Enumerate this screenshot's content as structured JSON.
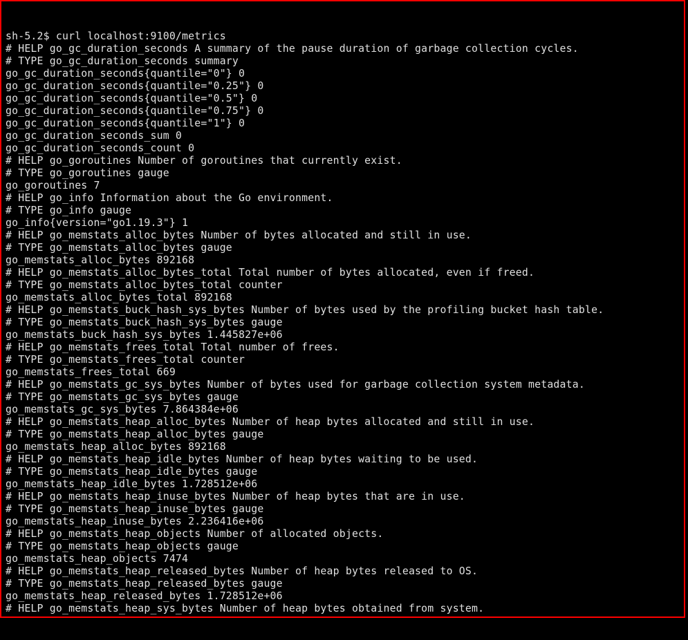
{
  "prompt": "sh-5.2$ ",
  "command": "curl localhost:9100/metrics",
  "lines": [
    "# HELP go_gc_duration_seconds A summary of the pause duration of garbage collection cycles.",
    "# TYPE go_gc_duration_seconds summary",
    "go_gc_duration_seconds{quantile=\"0\"} 0",
    "go_gc_duration_seconds{quantile=\"0.25\"} 0",
    "go_gc_duration_seconds{quantile=\"0.5\"} 0",
    "go_gc_duration_seconds{quantile=\"0.75\"} 0",
    "go_gc_duration_seconds{quantile=\"1\"} 0",
    "go_gc_duration_seconds_sum 0",
    "go_gc_duration_seconds_count 0",
    "# HELP go_goroutines Number of goroutines that currently exist.",
    "# TYPE go_goroutines gauge",
    "go_goroutines 7",
    "# HELP go_info Information about the Go environment.",
    "# TYPE go_info gauge",
    "go_info{version=\"go1.19.3\"} 1",
    "# HELP go_memstats_alloc_bytes Number of bytes allocated and still in use.",
    "# TYPE go_memstats_alloc_bytes gauge",
    "go_memstats_alloc_bytes 892168",
    "# HELP go_memstats_alloc_bytes_total Total number of bytes allocated, even if freed.",
    "# TYPE go_memstats_alloc_bytes_total counter",
    "go_memstats_alloc_bytes_total 892168",
    "# HELP go_memstats_buck_hash_sys_bytes Number of bytes used by the profiling bucket hash table.",
    "# TYPE go_memstats_buck_hash_sys_bytes gauge",
    "go_memstats_buck_hash_sys_bytes 1.445827e+06",
    "# HELP go_memstats_frees_total Total number of frees.",
    "# TYPE go_memstats_frees_total counter",
    "go_memstats_frees_total 669",
    "# HELP go_memstats_gc_sys_bytes Number of bytes used for garbage collection system metadata.",
    "# TYPE go_memstats_gc_sys_bytes gauge",
    "go_memstats_gc_sys_bytes 7.864384e+06",
    "# HELP go_memstats_heap_alloc_bytes Number of heap bytes allocated and still in use.",
    "# TYPE go_memstats_heap_alloc_bytes gauge",
    "go_memstats_heap_alloc_bytes 892168",
    "# HELP go_memstats_heap_idle_bytes Number of heap bytes waiting to be used.",
    "# TYPE go_memstats_heap_idle_bytes gauge",
    "go_memstats_heap_idle_bytes 1.728512e+06",
    "# HELP go_memstats_heap_inuse_bytes Number of heap bytes that are in use.",
    "# TYPE go_memstats_heap_inuse_bytes gauge",
    "go_memstats_heap_inuse_bytes 2.236416e+06",
    "# HELP go_memstats_heap_objects Number of allocated objects.",
    "# TYPE go_memstats_heap_objects gauge",
    "go_memstats_heap_objects 7474",
    "# HELP go_memstats_heap_released_bytes Number of heap bytes released to OS.",
    "# TYPE go_memstats_heap_released_bytes gauge",
    "go_memstats_heap_released_bytes 1.728512e+06",
    "# HELP go_memstats_heap_sys_bytes Number of heap bytes obtained from system."
  ]
}
